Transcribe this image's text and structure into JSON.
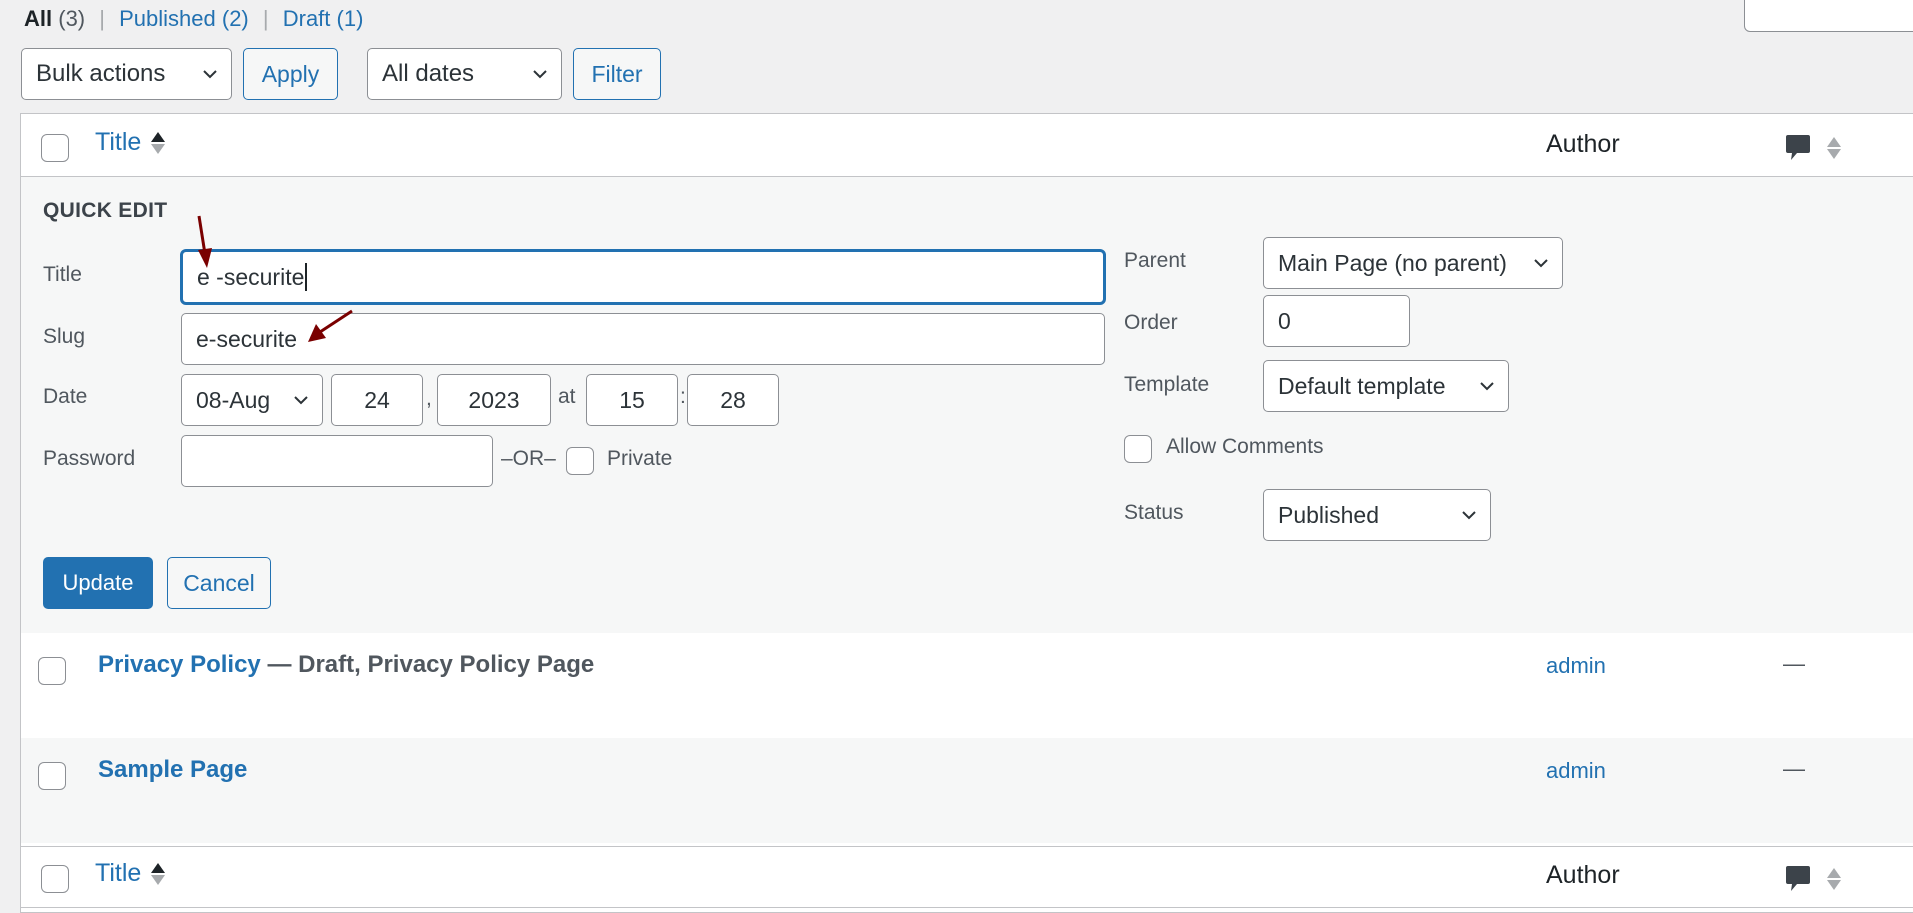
{
  "status_filters": [
    {
      "label": "All",
      "count": "(3)",
      "current": true
    },
    {
      "label": "Published",
      "count": "(2)",
      "current": false
    },
    {
      "label": "Draft",
      "count": "(1)",
      "current": false
    }
  ],
  "separator": "|",
  "toolbar": {
    "bulk_actions": "Bulk actions",
    "apply": "Apply",
    "dates": "All dates",
    "filter": "Filter"
  },
  "table": {
    "columns": {
      "title": "Title",
      "author": "Author",
      "comments_icon": "comment-bubble-icon"
    }
  },
  "quick_edit": {
    "heading": "QUICK EDIT",
    "labels": {
      "title": "Title",
      "slug": "Slug",
      "date": "Date",
      "password": "Password",
      "or": "–OR–",
      "private": "Private",
      "parent": "Parent",
      "order": "Order",
      "template": "Template",
      "allow_comments": "Allow Comments",
      "status": "Status",
      "date_comma": ",",
      "date_at": "at",
      "time_colon": ":"
    },
    "values": {
      "title": "e -securite",
      "slug": "e-securite",
      "month": "08-Aug",
      "day": "24",
      "year": "2023",
      "hour": "15",
      "minute": "28",
      "password": "",
      "private": false,
      "parent": "Main Page (no parent)",
      "order": "0",
      "template": "Default template",
      "allow_comments": false,
      "status": "Published"
    },
    "buttons": {
      "update": "Update",
      "cancel": "Cancel"
    }
  },
  "rows": [
    {
      "title": "Privacy Policy",
      "state": " — Draft, Privacy Policy Page",
      "author": "admin",
      "comments": "—"
    },
    {
      "title": "Sample Page",
      "state": "",
      "author": "admin",
      "comments": "—"
    }
  ],
  "colors": {
    "accent": "#2271b1",
    "annotation_arrow": "#7a0000"
  }
}
